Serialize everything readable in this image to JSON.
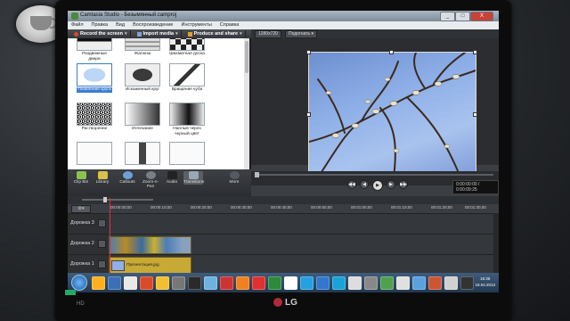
{
  "app": {
    "title": "Camtasia Studio - Безымянный.camproj",
    "window_buttons": [
      "_",
      "□",
      "X"
    ]
  },
  "menu": [
    "Файл",
    "Правка",
    "Вид",
    "Воспроизведение",
    "Инструменты",
    "Справка"
  ],
  "toolbar": {
    "record": "Record the screen",
    "import": "Import media",
    "produce": "Produce and share"
  },
  "preview_toolbar": {
    "resolution": "1280x720",
    "fit": "Подогнать",
    "zoom_arrow": "▾"
  },
  "library": {
    "tiles": [
      {
        "label": "Раздвижные двери",
        "style": "dark"
      },
      {
        "label": "Жалюзи",
        "style": "blinds"
      },
      {
        "label": "Шахматная доска",
        "style": "checker"
      },
      {
        "label": "Появление круга",
        "style": "circle",
        "selected": true
      },
      {
        "label": "Искаженный круг",
        "style": "dist"
      },
      {
        "label": "Вращение куба",
        "style": "cube"
      },
      {
        "label": "Растворение",
        "style": "noise"
      },
      {
        "label": "Исчезание",
        "style": "fade"
      },
      {
        "label": "Наплыв через черный цвет",
        "style": "black"
      },
      {
        "label": "",
        "style": "blank"
      },
      {
        "label": "",
        "style": "bar"
      },
      {
        "label": "",
        "style": "blank"
      }
    ]
  },
  "task_tabs": [
    {
      "label": "Clip Bin",
      "color": "#8bc34a"
    },
    {
      "label": "Library",
      "color": "#d9c14a"
    },
    {
      "label": "Callouts",
      "color": "#6fa0d8"
    },
    {
      "label": "Zoom-n-Pan",
      "color": "#7a7f86"
    },
    {
      "label": "Audio",
      "color": "#222222"
    },
    {
      "label": "Transitions",
      "color": "#9aa7b5",
      "active": true
    },
    {
      "label": "More",
      "color": "#555a60"
    }
  ],
  "player": {
    "timecode": "0:00:00:00 / 0:00:09:25",
    "buttons": [
      "◀◀",
      "◀",
      "▶",
      "▶",
      "▶▶"
    ]
  },
  "timeline": {
    "ruler": [
      "00:00:00;00",
      "00:00:10;00",
      "00:00:20;00",
      "00:00:30;00",
      "00:00:40;00",
      "00:00:50;00",
      "00:01:00;00",
      "00:01:10;00",
      "00:01:20;00",
      "00:01:30;00"
    ],
    "tracks": [
      {
        "name": "Дорожка 3"
      },
      {
        "name": "Дорожка 2"
      },
      {
        "name": "Дорожка 1",
        "clip_label": "Презентация.jpg"
      }
    ]
  },
  "taskbar": {
    "icons": [
      "#ffb020",
      "#3d6fb8",
      "#e8e8e8",
      "#d94a2a",
      "#f0c030",
      "#777777",
      "#2a2a2a",
      "#6fb2e0",
      "#c33",
      "#f08020",
      "#e03030",
      "#2c8a3a",
      "#ffffff",
      "#25a0e0",
      "#3377cc",
      "#1aa3d8",
      "#ddd",
      "#888",
      "#4fa04f",
      "#e0e0e0",
      "#5aa1e0",
      "#cc5533",
      "#d0d0d0",
      "#333"
    ],
    "clock_time": "16:36",
    "clock_date": "18.04.2013"
  },
  "monitor": {
    "brand": "LG",
    "badge": "HD"
  }
}
